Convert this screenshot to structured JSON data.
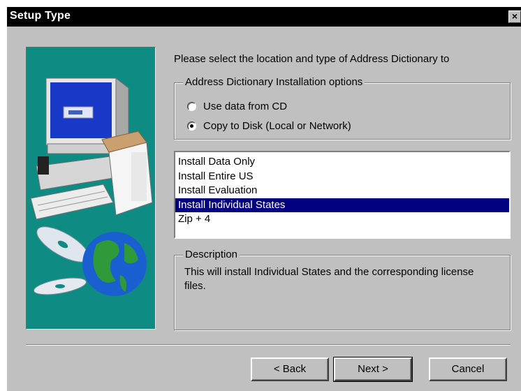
{
  "window": {
    "title": "Setup Type",
    "close_glyph": "×"
  },
  "intro_text": "Please select the location and type of Address Dictionary to",
  "install_options": {
    "legend": "Address Dictionary Installation options",
    "options": [
      {
        "label": "Use data from CD",
        "selected": false
      },
      {
        "label": "Copy to Disk (Local or Network)",
        "selected": true
      }
    ]
  },
  "install_list": {
    "items": [
      "Install Data Only",
      "Install Entire US",
      "Install Evaluation",
      "Install Individual States",
      "Zip + 4"
    ],
    "selected_index": 3
  },
  "description": {
    "legend": "Description",
    "text": "This will install Individual States and the corresponding license files."
  },
  "buttons": {
    "back": "< Back",
    "next": "Next >",
    "cancel": "Cancel"
  },
  "colors": {
    "dialog_bg": "#c0c0c0",
    "title_bar": "#000000",
    "art_bg": "#0e8c84",
    "selection": "#000080"
  },
  "art": {
    "icons": [
      "computer-monitor-icon",
      "software-box-icon",
      "cd-disc-icon",
      "globe-icon"
    ]
  }
}
